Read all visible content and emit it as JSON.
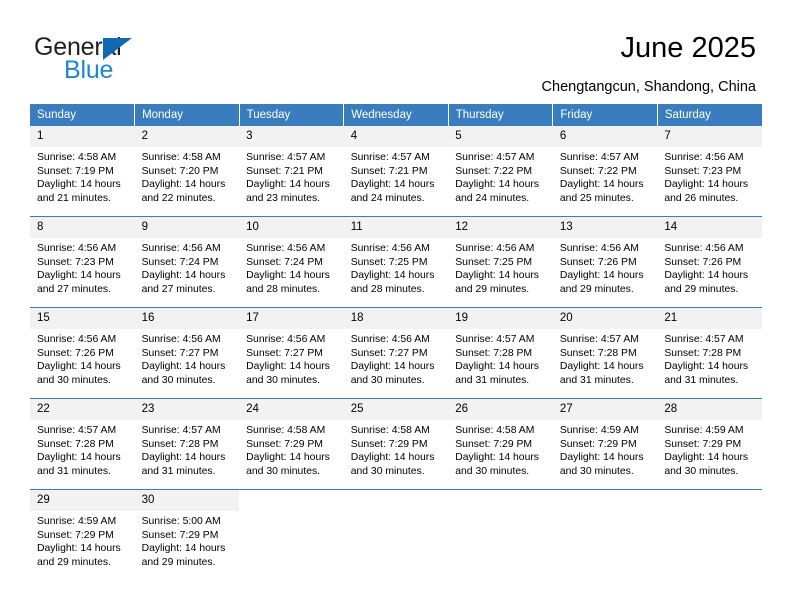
{
  "brand": {
    "name_part1": "General",
    "name_part2": "Blue",
    "triangle_color": "#1268b3",
    "blue_color": "#1b87d4"
  },
  "header": {
    "title": "June 2025",
    "subtitle": "Chengtangcun, Shandong, China"
  },
  "calendar": {
    "accent_color": "#3a7dbf",
    "daynum_bg": "#f2f2f2",
    "weekday_headers": [
      "Sunday",
      "Monday",
      "Tuesday",
      "Wednesday",
      "Thursday",
      "Friday",
      "Saturday"
    ],
    "weeks": [
      [
        {
          "day": "1",
          "sunrise": "Sunrise: 4:58 AM",
          "sunset": "Sunset: 7:19 PM",
          "daylight_line1": "Daylight: 14 hours",
          "daylight_line2": "and 21 minutes."
        },
        {
          "day": "2",
          "sunrise": "Sunrise: 4:58 AM",
          "sunset": "Sunset: 7:20 PM",
          "daylight_line1": "Daylight: 14 hours",
          "daylight_line2": "and 22 minutes."
        },
        {
          "day": "3",
          "sunrise": "Sunrise: 4:57 AM",
          "sunset": "Sunset: 7:21 PM",
          "daylight_line1": "Daylight: 14 hours",
          "daylight_line2": "and 23 minutes."
        },
        {
          "day": "4",
          "sunrise": "Sunrise: 4:57 AM",
          "sunset": "Sunset: 7:21 PM",
          "daylight_line1": "Daylight: 14 hours",
          "daylight_line2": "and 24 minutes."
        },
        {
          "day": "5",
          "sunrise": "Sunrise: 4:57 AM",
          "sunset": "Sunset: 7:22 PM",
          "daylight_line1": "Daylight: 14 hours",
          "daylight_line2": "and 24 minutes."
        },
        {
          "day": "6",
          "sunrise": "Sunrise: 4:57 AM",
          "sunset": "Sunset: 7:22 PM",
          "daylight_line1": "Daylight: 14 hours",
          "daylight_line2": "and 25 minutes."
        },
        {
          "day": "7",
          "sunrise": "Sunrise: 4:56 AM",
          "sunset": "Sunset: 7:23 PM",
          "daylight_line1": "Daylight: 14 hours",
          "daylight_line2": "and 26 minutes."
        }
      ],
      [
        {
          "day": "8",
          "sunrise": "Sunrise: 4:56 AM",
          "sunset": "Sunset: 7:23 PM",
          "daylight_line1": "Daylight: 14 hours",
          "daylight_line2": "and 27 minutes."
        },
        {
          "day": "9",
          "sunrise": "Sunrise: 4:56 AM",
          "sunset": "Sunset: 7:24 PM",
          "daylight_line1": "Daylight: 14 hours",
          "daylight_line2": "and 27 minutes."
        },
        {
          "day": "10",
          "sunrise": "Sunrise: 4:56 AM",
          "sunset": "Sunset: 7:24 PM",
          "daylight_line1": "Daylight: 14 hours",
          "daylight_line2": "and 28 minutes."
        },
        {
          "day": "11",
          "sunrise": "Sunrise: 4:56 AM",
          "sunset": "Sunset: 7:25 PM",
          "daylight_line1": "Daylight: 14 hours",
          "daylight_line2": "and 28 minutes."
        },
        {
          "day": "12",
          "sunrise": "Sunrise: 4:56 AM",
          "sunset": "Sunset: 7:25 PM",
          "daylight_line1": "Daylight: 14 hours",
          "daylight_line2": "and 29 minutes."
        },
        {
          "day": "13",
          "sunrise": "Sunrise: 4:56 AM",
          "sunset": "Sunset: 7:26 PM",
          "daylight_line1": "Daylight: 14 hours",
          "daylight_line2": "and 29 minutes."
        },
        {
          "day": "14",
          "sunrise": "Sunrise: 4:56 AM",
          "sunset": "Sunset: 7:26 PM",
          "daylight_line1": "Daylight: 14 hours",
          "daylight_line2": "and 29 minutes."
        }
      ],
      [
        {
          "day": "15",
          "sunrise": "Sunrise: 4:56 AM",
          "sunset": "Sunset: 7:26 PM",
          "daylight_line1": "Daylight: 14 hours",
          "daylight_line2": "and 30 minutes."
        },
        {
          "day": "16",
          "sunrise": "Sunrise: 4:56 AM",
          "sunset": "Sunset: 7:27 PM",
          "daylight_line1": "Daylight: 14 hours",
          "daylight_line2": "and 30 minutes."
        },
        {
          "day": "17",
          "sunrise": "Sunrise: 4:56 AM",
          "sunset": "Sunset: 7:27 PM",
          "daylight_line1": "Daylight: 14 hours",
          "daylight_line2": "and 30 minutes."
        },
        {
          "day": "18",
          "sunrise": "Sunrise: 4:56 AM",
          "sunset": "Sunset: 7:27 PM",
          "daylight_line1": "Daylight: 14 hours",
          "daylight_line2": "and 30 minutes."
        },
        {
          "day": "19",
          "sunrise": "Sunrise: 4:57 AM",
          "sunset": "Sunset: 7:28 PM",
          "daylight_line1": "Daylight: 14 hours",
          "daylight_line2": "and 31 minutes."
        },
        {
          "day": "20",
          "sunrise": "Sunrise: 4:57 AM",
          "sunset": "Sunset: 7:28 PM",
          "daylight_line1": "Daylight: 14 hours",
          "daylight_line2": "and 31 minutes."
        },
        {
          "day": "21",
          "sunrise": "Sunrise: 4:57 AM",
          "sunset": "Sunset: 7:28 PM",
          "daylight_line1": "Daylight: 14 hours",
          "daylight_line2": "and 31 minutes."
        }
      ],
      [
        {
          "day": "22",
          "sunrise": "Sunrise: 4:57 AM",
          "sunset": "Sunset: 7:28 PM",
          "daylight_line1": "Daylight: 14 hours",
          "daylight_line2": "and 31 minutes."
        },
        {
          "day": "23",
          "sunrise": "Sunrise: 4:57 AM",
          "sunset": "Sunset: 7:28 PM",
          "daylight_line1": "Daylight: 14 hours",
          "daylight_line2": "and 31 minutes."
        },
        {
          "day": "24",
          "sunrise": "Sunrise: 4:58 AM",
          "sunset": "Sunset: 7:29 PM",
          "daylight_line1": "Daylight: 14 hours",
          "daylight_line2": "and 30 minutes."
        },
        {
          "day": "25",
          "sunrise": "Sunrise: 4:58 AM",
          "sunset": "Sunset: 7:29 PM",
          "daylight_line1": "Daylight: 14 hours",
          "daylight_line2": "and 30 minutes."
        },
        {
          "day": "26",
          "sunrise": "Sunrise: 4:58 AM",
          "sunset": "Sunset: 7:29 PM",
          "daylight_line1": "Daylight: 14 hours",
          "daylight_line2": "and 30 minutes."
        },
        {
          "day": "27",
          "sunrise": "Sunrise: 4:59 AM",
          "sunset": "Sunset: 7:29 PM",
          "daylight_line1": "Daylight: 14 hours",
          "daylight_line2": "and 30 minutes."
        },
        {
          "day": "28",
          "sunrise": "Sunrise: 4:59 AM",
          "sunset": "Sunset: 7:29 PM",
          "daylight_line1": "Daylight: 14 hours",
          "daylight_line2": "and 30 minutes."
        }
      ],
      [
        {
          "day": "29",
          "sunrise": "Sunrise: 4:59 AM",
          "sunset": "Sunset: 7:29 PM",
          "daylight_line1": "Daylight: 14 hours",
          "daylight_line2": "and 29 minutes."
        },
        {
          "day": "30",
          "sunrise": "Sunrise: 5:00 AM",
          "sunset": "Sunset: 7:29 PM",
          "daylight_line1": "Daylight: 14 hours",
          "daylight_line2": "and 29 minutes."
        },
        {
          "day": "",
          "sunrise": "",
          "sunset": "",
          "daylight_line1": "",
          "daylight_line2": ""
        },
        {
          "day": "",
          "sunrise": "",
          "sunset": "",
          "daylight_line1": "",
          "daylight_line2": ""
        },
        {
          "day": "",
          "sunrise": "",
          "sunset": "",
          "daylight_line1": "",
          "daylight_line2": ""
        },
        {
          "day": "",
          "sunrise": "",
          "sunset": "",
          "daylight_line1": "",
          "daylight_line2": ""
        },
        {
          "day": "",
          "sunrise": "",
          "sunset": "",
          "daylight_line1": "",
          "daylight_line2": ""
        }
      ]
    ]
  }
}
